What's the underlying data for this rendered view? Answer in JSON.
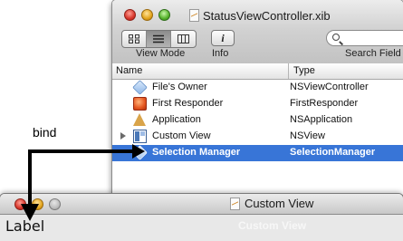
{
  "xib_window": {
    "title": "StatusViewController.xib",
    "toolbar": {
      "view_mode_label": "View Mode",
      "info_label": "Info",
      "search_label": "Search Field",
      "view_mode_icons": [
        "icon-grid",
        "list-icon",
        "column-icon"
      ],
      "info_glyph": "i"
    },
    "columns": {
      "name": "Name",
      "type": "Type"
    },
    "rows": [
      {
        "name": "File's Owner",
        "type": "NSViewController",
        "icon": "cube-icon"
      },
      {
        "name": "First Responder",
        "type": "FirstResponder",
        "icon": "responder-icon"
      },
      {
        "name": "Application",
        "type": "NSApplication",
        "icon": "application-icon"
      },
      {
        "name": "Custom View",
        "type": "NSView",
        "icon": "view-icon"
      },
      {
        "name": "Selection Manager",
        "type": "SelectionManager",
        "icon": "cube-icon",
        "selected": true
      }
    ]
  },
  "custom_view_window": {
    "title": "Custom View",
    "label_text": "Label",
    "ghost_title": "Custom View"
  },
  "annotation": {
    "bind_text": "bind"
  },
  "colors": {
    "selection": "#3875d7",
    "arrow": "#000000"
  }
}
